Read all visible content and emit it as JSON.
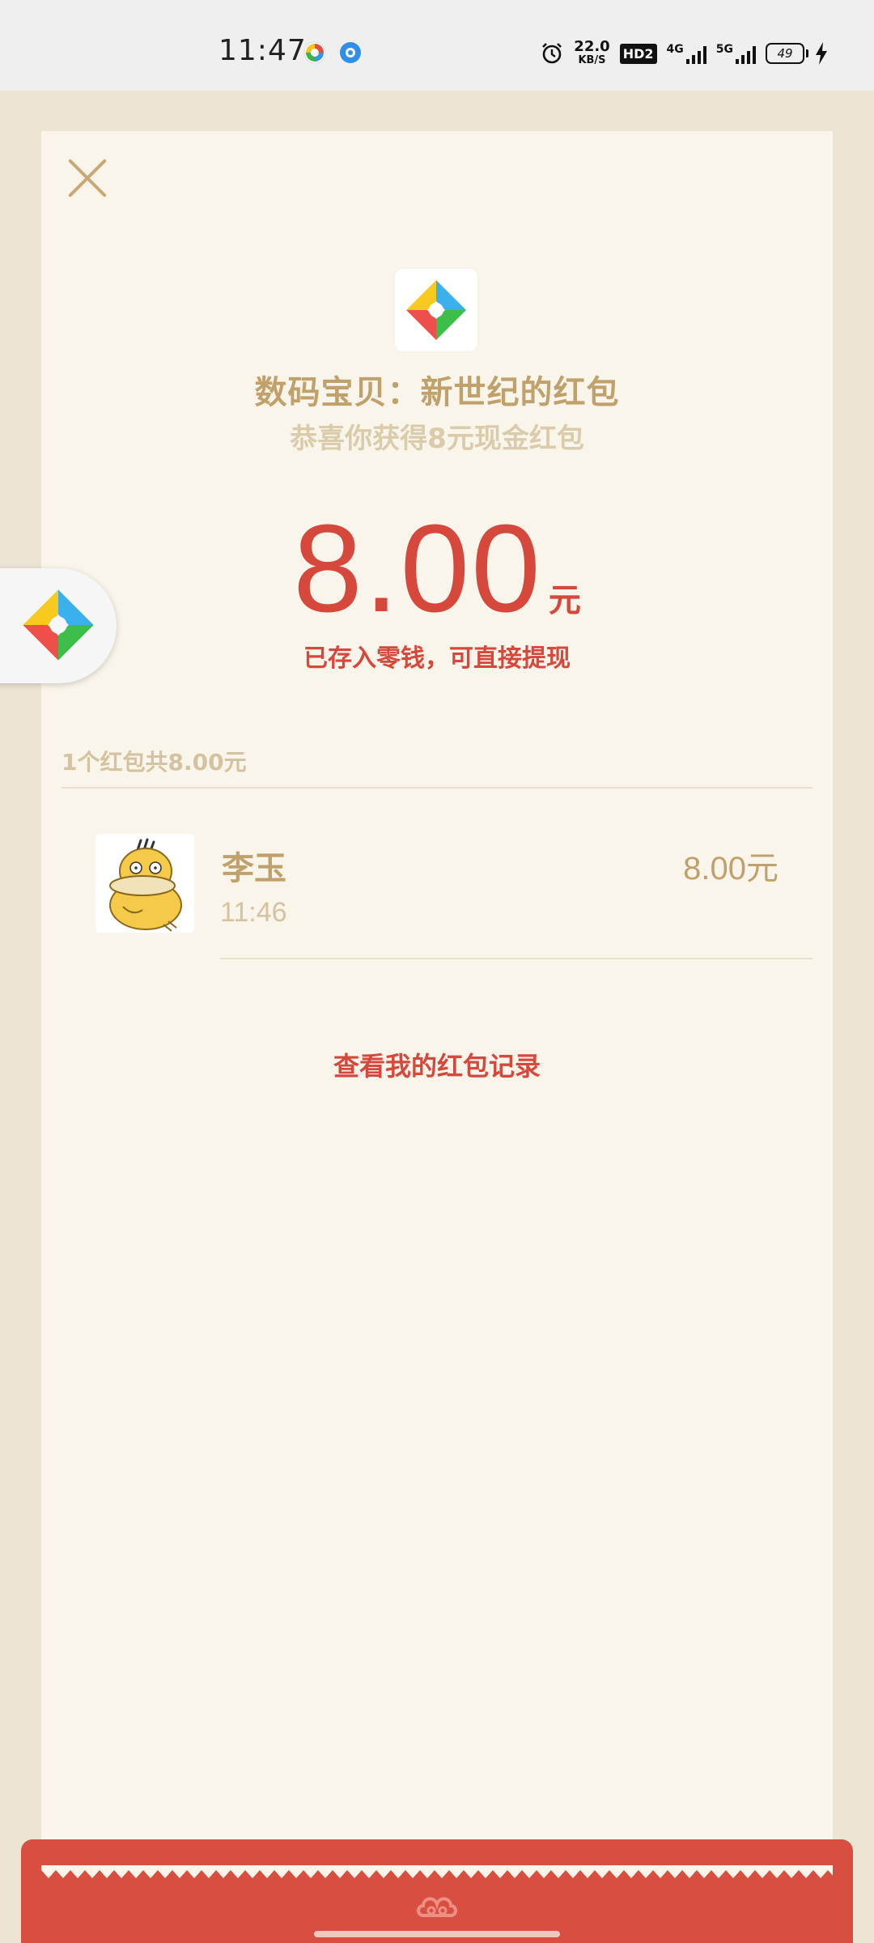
{
  "status_bar": {
    "time": "11:47",
    "net_speed": "22.0",
    "net_speed_unit": "KB/S",
    "hd_label": "HD2",
    "network_4g": "4G",
    "network_5g": "5G",
    "battery": "49"
  },
  "close_icon": "close-icon",
  "sender": {
    "logo_icon": "pinwheel-logo-icon",
    "title": "数码宝贝：新世纪的红包",
    "subtitle": "恭喜你获得8元现金红包"
  },
  "amount": {
    "value": "8.00",
    "unit": "元",
    "note": "已存入零钱，可直接提现"
  },
  "summary": "1个红包共8.00元",
  "receivers": [
    {
      "name": "李玉",
      "time": "11:46",
      "amount": "8.00元",
      "avatar_icon": "yellow-duck-avatar"
    }
  ],
  "records_link": "查看我的红包记录",
  "floating_button_icon": "pinwheel-logo-icon",
  "colors": {
    "accent_red": "#d6473c",
    "gold_text": "#c0a06b",
    "muted_gold": "#d4c2a0",
    "card_bg": "#f9f5ea",
    "page_bg": "#ede5d3",
    "packet_red": "#d84f42"
  }
}
